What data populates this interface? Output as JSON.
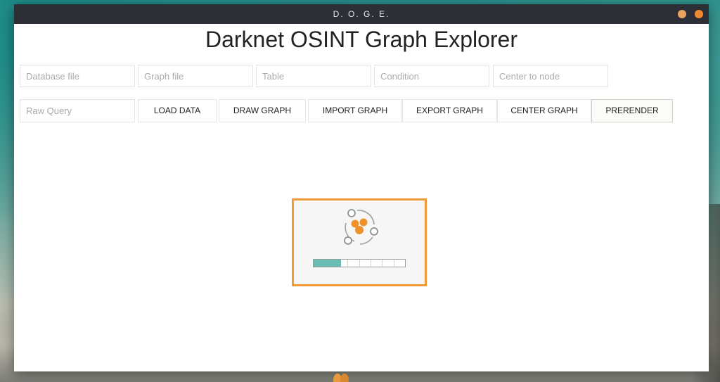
{
  "window": {
    "title": "D. O. G. E.",
    "minimize_color": "#e9a45f",
    "close_color": "#f08a30"
  },
  "app": {
    "title": "Darknet OSINT Graph Explorer"
  },
  "inputs": {
    "database_file": {
      "value": "",
      "placeholder": "Database file"
    },
    "graph_file": {
      "value": "",
      "placeholder": "Graph file"
    },
    "table": {
      "value": "",
      "placeholder": "Table"
    },
    "condition": {
      "value": "",
      "placeholder": "Condition"
    },
    "center_to_node": {
      "value": "",
      "placeholder": "Center to node"
    },
    "raw_query": {
      "value": "",
      "placeholder": "Raw Query"
    }
  },
  "buttons": {
    "load_data": "LOAD DATA",
    "draw_graph": "DRAW GRAPH",
    "import_graph": "IMPORT GRAPH",
    "export_graph": "EXPORT GRAPH",
    "center_graph": "CENTER GRAPH",
    "prerender": "PRERENDER"
  },
  "loader": {
    "icon": "graph-nodes-icon",
    "progress_fraction": 0.3,
    "segments": 8,
    "accent_color": "#f29a38",
    "fill_color": "#6bbdb4"
  }
}
